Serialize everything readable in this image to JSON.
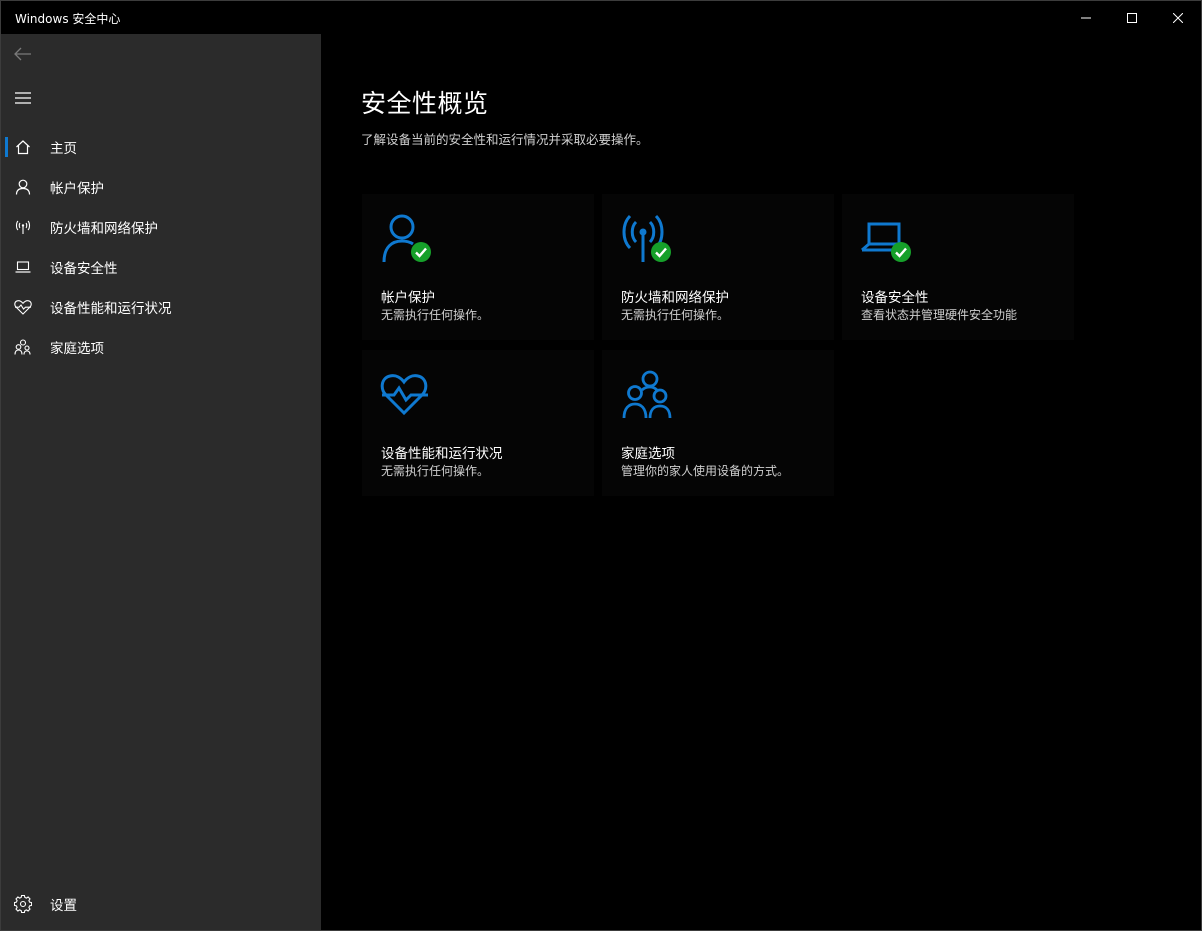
{
  "window": {
    "title": "Windows 安全中心"
  },
  "sidebar": {
    "items": [
      {
        "id": "home",
        "label": "主页",
        "icon": "home-icon",
        "active": true
      },
      {
        "id": "account",
        "label": "帐户保护",
        "icon": "person-icon"
      },
      {
        "id": "firewall",
        "label": "防火墙和网络保护",
        "icon": "antenna-icon"
      },
      {
        "id": "device-security",
        "label": "设备安全性",
        "icon": "laptop-icon"
      },
      {
        "id": "device-health",
        "label": "设备性能和运行状况",
        "icon": "heart-icon"
      },
      {
        "id": "family",
        "label": "家庭选项",
        "icon": "family-icon"
      }
    ],
    "settings_label": "设置"
  },
  "main": {
    "title": "安全性概览",
    "subtitle": "了解设备当前的安全性和运行情况并采取必要操作。",
    "tiles": [
      {
        "name": "帐户保护",
        "desc": "无需执行任何操作。",
        "icon": "person-icon",
        "status": "ok"
      },
      {
        "name": "防火墙和网络保护",
        "desc": "无需执行任何操作。",
        "icon": "antenna-icon",
        "status": "ok"
      },
      {
        "name": "设备安全性",
        "desc": "查看状态并管理硬件安全功能",
        "icon": "laptop-icon",
        "status": "ok"
      },
      {
        "name": "设备性能和运行状况",
        "desc": "无需执行任何操作。",
        "icon": "heart-icon"
      },
      {
        "name": "家庭选项",
        "desc": "管理你的家人使用设备的方式。",
        "icon": "family-icon"
      }
    ]
  },
  "colors": {
    "accent": "#0f79d0",
    "ok_green": "#16a02a",
    "sidebar_bg": "#2b2b2b",
    "main_bg": "#000000"
  }
}
